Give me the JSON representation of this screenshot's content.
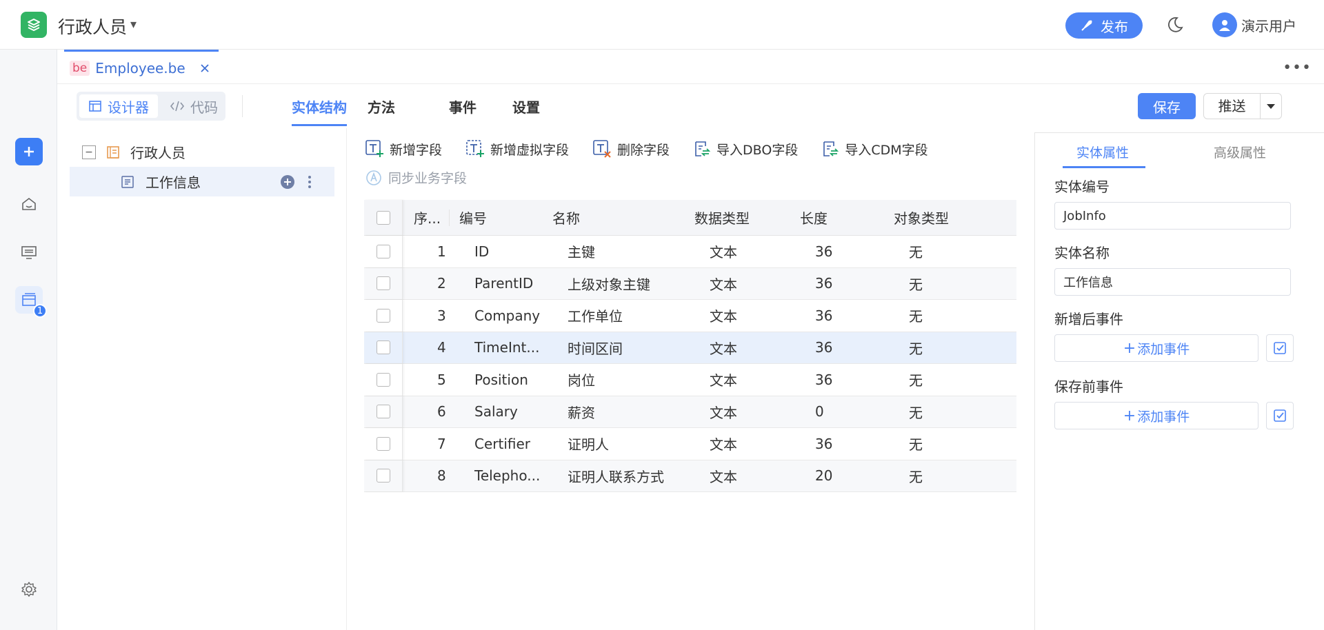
{
  "app": {
    "title": "行政人员",
    "publish_label": "发布",
    "user_name": "演示用户"
  },
  "file_tab": {
    "badge": "be",
    "name": "Employee.be"
  },
  "view_toggle": {
    "designer": "设计器",
    "code": "代码"
  },
  "main_tabs": [
    "实体结构",
    "方法",
    "事件",
    "设置"
  ],
  "buttons": {
    "save": "保存",
    "push": "推送"
  },
  "rail": {
    "badge_count": "1"
  },
  "tree": {
    "root": "行政人员",
    "child": "工作信息"
  },
  "actions": [
    "新增字段",
    "新增虚拟字段",
    "删除字段",
    "导入DBO字段",
    "导入CDM字段"
  ],
  "sync_label": "同步业务字段",
  "table": {
    "headers": [
      "序...",
      "编号",
      "名称",
      "数据类型",
      "长度",
      "对象类型"
    ],
    "rows": [
      [
        "1",
        "ID",
        "主键",
        "文本",
        "36",
        "无"
      ],
      [
        "2",
        "ParentID",
        "上级对象主键",
        "文本",
        "36",
        "无"
      ],
      [
        "3",
        "Company",
        "工作单位",
        "文本",
        "36",
        "无"
      ],
      [
        "4",
        "TimeInt...",
        "时间区间",
        "文本",
        "36",
        "无"
      ],
      [
        "5",
        "Position",
        "岗位",
        "文本",
        "36",
        "无"
      ],
      [
        "6",
        "Salary",
        "薪资",
        "文本",
        "0",
        "无"
      ],
      [
        "7",
        "Certifier",
        "证明人",
        "文本",
        "36",
        "无"
      ],
      [
        "8",
        "Telepho...",
        "证明人联系方式",
        "文本",
        "20",
        "无"
      ]
    ]
  },
  "props": {
    "tabs": [
      "实体属性",
      "高级属性"
    ],
    "code_label": "实体编号",
    "code_value": "JobInfo",
    "name_label": "实体名称",
    "name_value": "工作信息",
    "after_add_label": "新增后事件",
    "before_save_label": "保存前事件",
    "add_event_label": "添加事件"
  }
}
